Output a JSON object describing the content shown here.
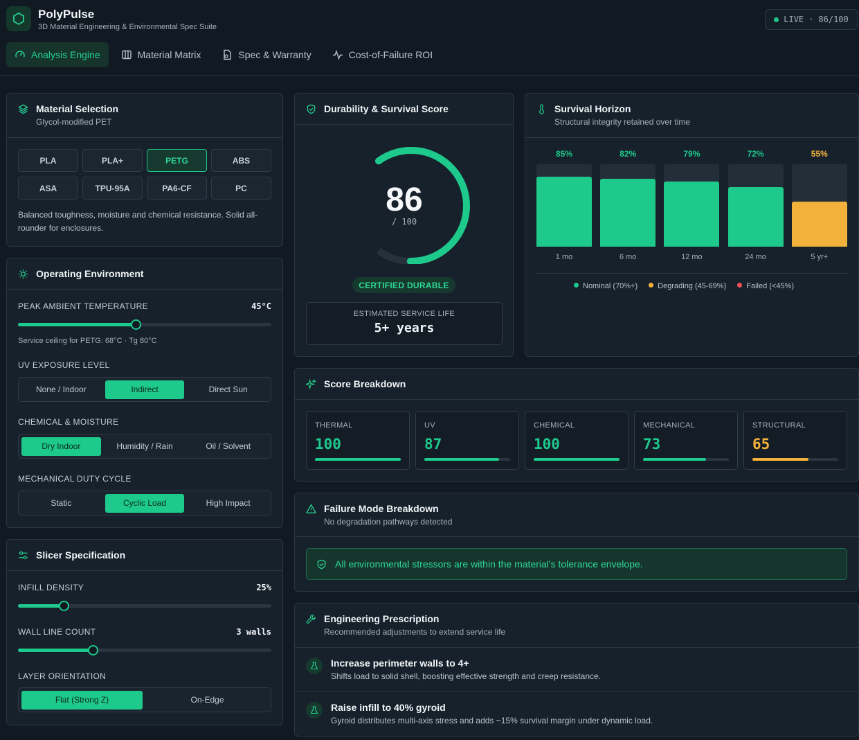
{
  "app": {
    "name": "PolyPulse",
    "subtitle": "3D Material Engineering & Environmental Spec Suite",
    "live_label": "LIVE",
    "live_sep": "·",
    "live_score": "86/100"
  },
  "nav": {
    "tabs": [
      {
        "label": "Analysis Engine",
        "icon": "gauge-icon",
        "active": true
      },
      {
        "label": "Material Matrix",
        "icon": "columns-icon",
        "active": false
      },
      {
        "label": "Spec & Warranty",
        "icon": "document-icon",
        "active": false
      },
      {
        "label": "Cost-of-Failure ROI",
        "icon": "activity-icon",
        "active": false
      }
    ]
  },
  "material": {
    "title": "Material Selection",
    "subtitle": "Glycol-modified PET",
    "options": [
      "PLA",
      "PLA+",
      "PETG",
      "ABS",
      "ASA",
      "TPU-95A",
      "PA6-CF",
      "PC"
    ],
    "selected": "PETG",
    "description": "Balanced toughness, moisture and chemical resistance. Solid all-rounder for enclosures."
  },
  "environment": {
    "title": "Operating Environment",
    "temp_label": "PEAK AMBIENT TEMPERATURE",
    "temp_value": "45°C",
    "temp_fraction": 0.465,
    "temp_note": "Service ceiling for PETG: 68°C · Tg 80°C",
    "uv_label": "UV EXPOSURE LEVEL",
    "uv_options": [
      "None / Indoor",
      "Indirect",
      "Direct Sun"
    ],
    "uv_selected": 1,
    "chem_label": "CHEMICAL & MOISTURE",
    "chem_options": [
      "Dry Indoor",
      "Humidity / Rain",
      "Oil / Solvent"
    ],
    "chem_selected": 0,
    "mech_label": "MECHANICAL DUTY CYCLE",
    "mech_options": [
      "Static",
      "Cyclic Load",
      "High Impact"
    ],
    "mech_selected": 1
  },
  "slicer": {
    "title": "Slicer Specification",
    "infill_label": "INFILL DENSITY",
    "infill_value": "25%",
    "infill_fraction": 0.18,
    "walls_label": "WALL LINE COUNT",
    "walls_value": "3 walls",
    "walls_fraction": 0.295,
    "orient_label": "LAYER ORIENTATION",
    "orient_options": [
      "Flat (Strong Z)",
      "On-Edge"
    ],
    "orient_selected": 0
  },
  "score": {
    "title": "Durability & Survival Score",
    "value": "86",
    "max": "/ 100",
    "fraction": 0.86,
    "badge": "CERTIFIED DURABLE",
    "life_label": "ESTIMATED SERVICE LIFE",
    "life_value": "5+ years"
  },
  "horizon": {
    "title": "Survival Horizon",
    "subtitle": "Structural integrity retained over time",
    "legend": [
      {
        "label": "Nominal (70%+)",
        "color": "#1ec98c"
      },
      {
        "label": "Degrading (45-69%)",
        "color": "#f2b13a"
      },
      {
        "label": "Failed (<45%)",
        "color": "#f0505c"
      }
    ]
  },
  "chart_data": {
    "type": "bar",
    "categories": [
      "1 mo",
      "6 mo",
      "12 mo",
      "24 mo",
      "5 yr+"
    ],
    "values": [
      85,
      82,
      79,
      72,
      55
    ],
    "value_labels": [
      "85%",
      "82%",
      "79%",
      "72%",
      "55%"
    ],
    "colors": [
      "#1ec98c",
      "#1ec98c",
      "#1ec98c",
      "#1ec98c",
      "#f2b13a"
    ],
    "ylim": [
      0,
      100
    ],
    "title": "Survival Horizon",
    "legend_position": "bottom"
  },
  "breakdown": {
    "title": "Score Breakdown",
    "items": [
      {
        "label": "THERMAL",
        "value": "100",
        "fraction": 1.0,
        "color": "#1ec98c"
      },
      {
        "label": "UV",
        "value": "87",
        "fraction": 0.87,
        "color": "#1ec98c"
      },
      {
        "label": "CHEMICAL",
        "value": "100",
        "fraction": 1.0,
        "color": "#1ec98c"
      },
      {
        "label": "MECHANICAL",
        "value": "73",
        "fraction": 0.73,
        "color": "#1ec98c"
      },
      {
        "label": "STRUCTURAL",
        "value": "65",
        "fraction": 0.65,
        "color": "#f2b13a"
      }
    ]
  },
  "failure": {
    "title": "Failure Mode Breakdown",
    "subtitle": "No degradation pathways detected",
    "banner": "All environmental stressors are within the material's tolerance envelope."
  },
  "prescription": {
    "title": "Engineering Prescription",
    "subtitle": "Recommended adjustments to extend service life",
    "items": [
      {
        "title": "Increase perimeter walls to 4+",
        "desc": "Shifts load to solid shell, boosting effective strength and creep resistance."
      },
      {
        "title": "Raise infill to 40% gyroid",
        "desc": "Gyroid distributes multi-axis stress and adds ~15% survival margin under dynamic load."
      }
    ]
  },
  "colors": {
    "accent": "#1ec98c",
    "warning": "#f2b13a",
    "danger": "#f0505c",
    "background": "#111a22",
    "card": "#17212b"
  }
}
